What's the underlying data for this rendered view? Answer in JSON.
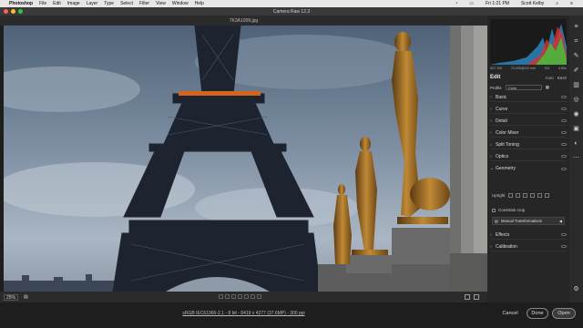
{
  "menubar": {
    "app": "Photoshop",
    "items": [
      "File",
      "Edit",
      "Image",
      "Layer",
      "Type",
      "Select",
      "Filter",
      "View",
      "Window",
      "Help"
    ],
    "clock": "Fri 1:21 PM",
    "user": "Scott Kelby"
  },
  "window": {
    "title": "Camera Raw 12.3",
    "filename": "7K3A1009.jpg"
  },
  "bottombar": {
    "zoom": "25%"
  },
  "workflow_link": "sRGB IEC61966-2.1 - 8 bit - 8419 x 4277 (37.6MP) - 300 ppi",
  "buttons": {
    "cancel": "Cancel",
    "done": "Done",
    "open": "Open"
  },
  "panel": {
    "camera_info": [
      "ISO 100",
      "70-200@110 mm",
      "f/11",
      "0.80s"
    ],
    "edit_title": "Edit",
    "auto": "Auto",
    "bw": "B&W",
    "profile_label": "Profile",
    "profile_value": "Color",
    "sections": [
      "Basic",
      "Curve",
      "Detail",
      "Color Mixer",
      "Split Toning",
      "Optics",
      "Geometry",
      "Effects",
      "Calibration"
    ],
    "upright_label": "Upright",
    "constrain_crop": "Constrain crop",
    "manual_transformations": "Manual Transformations"
  },
  "colors": {
    "sky_top": "#5b6f86",
    "sky_bottom": "#b8c3cf",
    "tower": "#1d2430",
    "statue": "#b07a2a",
    "panel_bg": "#262626"
  }
}
